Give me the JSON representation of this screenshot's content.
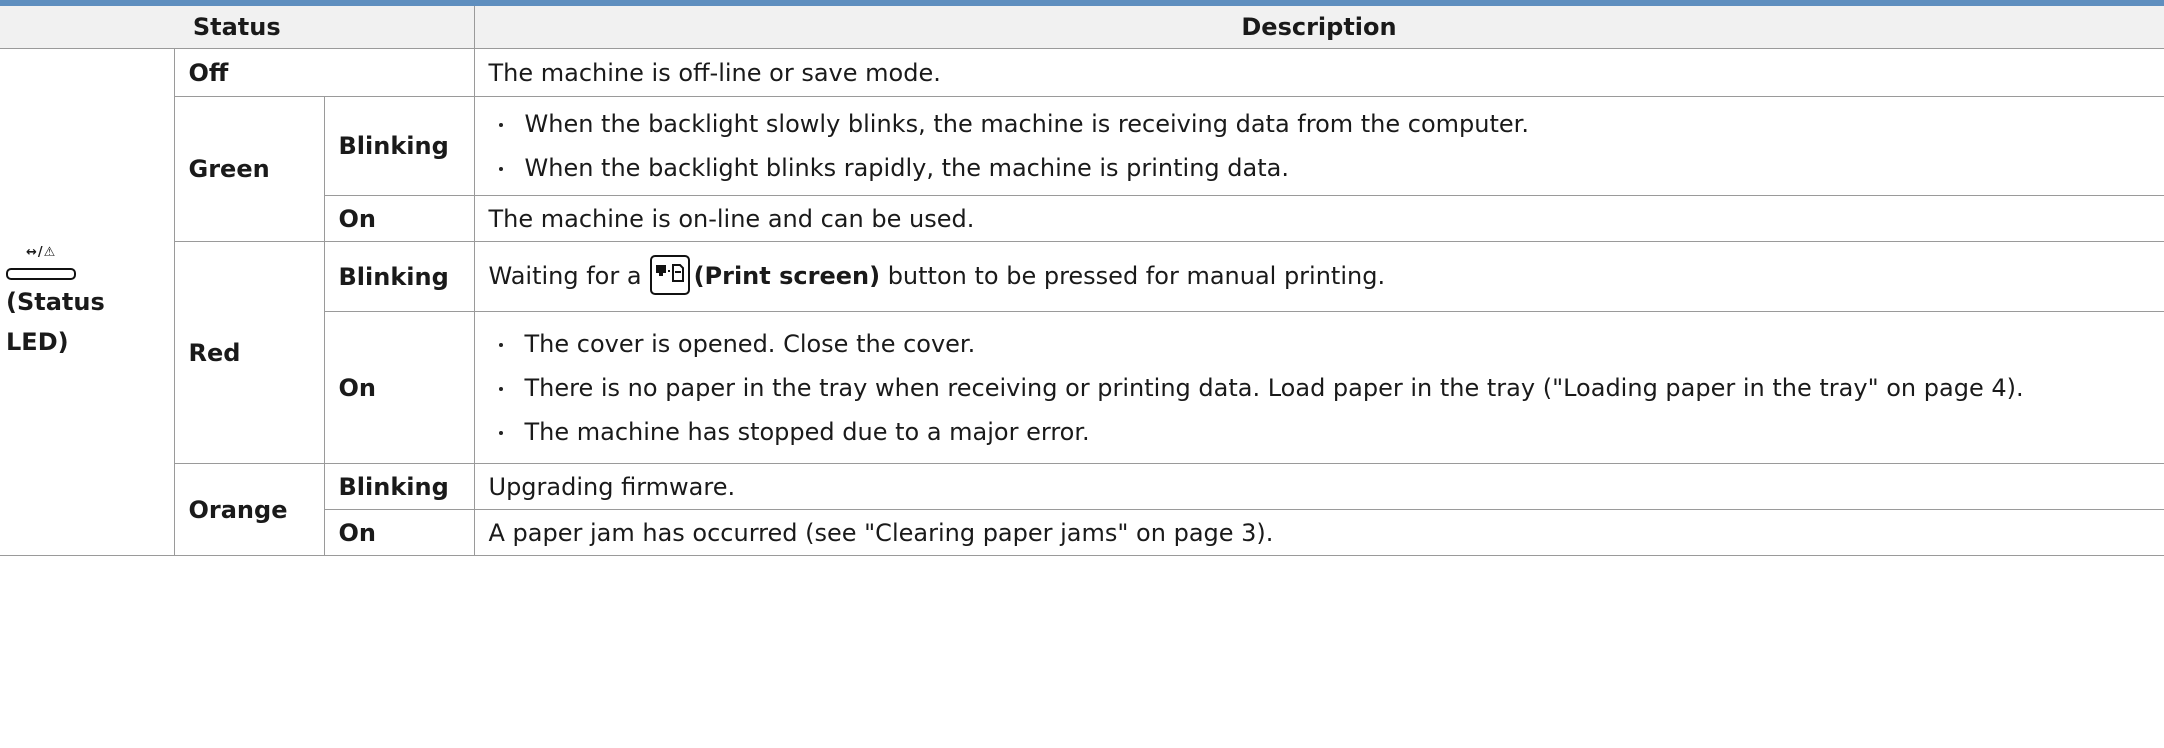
{
  "header": {
    "status": "Status",
    "description": "Description"
  },
  "led": {
    "label": "(Status LED)",
    "icon_glyphs": "↔/⚠"
  },
  "rows": {
    "off": {
      "state": "Off",
      "desc": "The machine is off-line or save mode."
    },
    "green": {
      "color": "Green",
      "blinking": {
        "mode": "Blinking",
        "bullets": [
          "When the backlight slowly blinks, the machine is receiving data from the computer.",
          "When the backlight blinks rapidly, the machine is printing data."
        ]
      },
      "on": {
        "mode": "On",
        "desc": "The machine is on-line and can be used."
      }
    },
    "red": {
      "color": "Red",
      "blinking": {
        "mode": "Blinking",
        "desc_pre": "Waiting for a",
        "button_label": "(Print screen)",
        "desc_post": " button to be pressed for manual printing."
      },
      "on": {
        "mode": "On",
        "bullets": [
          "The cover is opened. Close the cover.",
          "There is no paper in the tray when receiving or printing data. Load paper in the tray (\"Loading paper in the tray\" on page 4).",
          "The machine has stopped due to a major error."
        ]
      }
    },
    "orange": {
      "color": "Orange",
      "blinking": {
        "mode": "Blinking",
        "desc": "Upgrading firmware."
      },
      "on": {
        "mode": "On",
        "desc": "A paper jam has occurred (see \"Clearing paper jams\" on page 3)."
      }
    }
  },
  "colors": {
    "accent_bar": "#5f8fbf",
    "header_bg": "#f1f1f1",
    "border": "#9a9a9a"
  }
}
